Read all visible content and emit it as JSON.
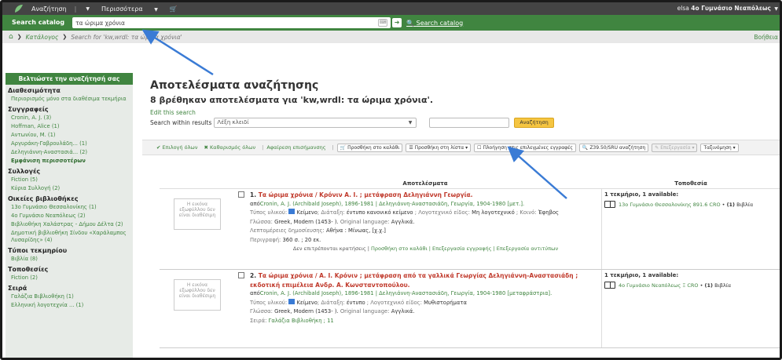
{
  "topbar": {
    "nav_search": "Αναζήτηση",
    "nav_more": "Περισσότερα",
    "user_name": "elsa",
    "user_library": "4ο Γυμνάσιο Νεαπόλεως"
  },
  "searchbar": {
    "tab_label": "Search catalog",
    "query": "τα ώριμα χρόνια",
    "submit_link": "Search catalog"
  },
  "breadcrumb": {
    "catalog": "Κατάλογος",
    "search_label": "Search",
    "search_query": "for 'kw,wrdl: τα ώριμα χρόνια'",
    "help": "Βοήθεια"
  },
  "sidebar": {
    "header": "Βελτιώστε την αναζήτησή σας",
    "availability": {
      "title": "Διαθεσιμότητα",
      "items": [
        "Περιορισμός μόνο στα διαθέσιμα τεκμήρια"
      ]
    },
    "authors": {
      "title": "Συγγραφείς",
      "items": [
        "Cronin, A. J. (3)",
        "Hoffman, Alice (1)",
        "Αντωνίου, Μ. (1)",
        "Αργυράκη-Γαβρουλάδη... (1)",
        "Δεληγιάννη-Αναστασιά... (2)"
      ],
      "more": "Εμφάνιση περισσοτέρων"
    },
    "collections": {
      "title": "Συλλογές",
      "items": [
        "Fiction (5)",
        "Κύρια Συλλογή (2)"
      ]
    },
    "home_libraries": {
      "title": "Οικείες βιβλιοθήκες",
      "items": [
        "13ο Γυμνάσιο Θεσσαλονίκης (1)",
        "4ο Γυμνάσιο Νεαπόλεως (2)",
        "Βιβλιοθήκη Χαλάστρας - Δήμου Δέλτα (2)",
        "Δημοτική βιβλιοθήκη Σίνδου «Χαράλαμπος Λυσαρίδης» (4)"
      ]
    },
    "item_types": {
      "title": "Τύποι τεκμηρίου",
      "items": [
        "Βιβλία (8)"
      ]
    },
    "locations": {
      "title": "Τοποθεσίες",
      "items": [
        "Fiction (2)"
      ]
    },
    "series": {
      "title": "Σειρά",
      "items": [
        "Γαλάζια Βιβλιοθήκη (1)",
        "Ελληνική λογοτεχνία ... (1)"
      ]
    }
  },
  "main": {
    "heading": "Αποτελέσματα αναζήτησης",
    "summary": "8 βρέθηκαν αποτελέσματα για 'kw,wrdl: τα ώριμα χρόνια'.",
    "edit_search": "Edit this search",
    "within_label": "Search within results",
    "within_select": "Λέξη κλειδί",
    "within_button": "Αναζήτηση"
  },
  "toolbar": {
    "select_all": "Επιλογή όλων",
    "clear_all": "Καθαρισμός όλων",
    "remove_highlight": "Αφαίρεση επισήμανσης",
    "add_cart": "Προσθήκη στο καλάθι",
    "add_list": "Προσθήκη στη λίστα",
    "merge": "Πλοήγηση στις επιλεγμένες εγγραφές",
    "z3950": "Z39.50/SRU αναζήτηση",
    "edit": "Επεξεργασία",
    "sort": "Ταξινόμηση"
  },
  "table": {
    "col_results": "Αποτελέσματα",
    "col_location": "Τοποθεσία",
    "no_image": "Η εικόνα εξωφύλλου δεν είναι διαθέσιμη",
    "rows": [
      {
        "num": "1.",
        "title": "Τα ώριμα χρόνια / Κρόνιν Α. Ι. ; μετάφραση Δεληγιάννη Γεωργία.",
        "by": "από",
        "authors": "Cronin, A. J. (Archibald Joseph), 1896-1981 | Δεληγιάννη-Αναστασιάδη, Γεωργία, 1904-1980 [μετ.].",
        "material_label": "Τύπος υλικού:",
        "material": "Κείμενο",
        "format_label": "Διάταξη:",
        "format": "έντυπο κανονικό κείμενο",
        "genre_label": "Λογοτεχνικό είδος:",
        "genre": "Μη λογοτεχνικό",
        "content_label": "Κοινό:",
        "content": "Έφηβος",
        "language_label": "Γλώσσα:",
        "language": "Greek, Modern (1453- ).",
        "orig_label": "Original language:",
        "orig": "Αγγλικά.",
        "pub_label": "Λεπτομέρειες δημοσίευσης:",
        "pub": "Αθήνα : Μίνωας, [χ.χ.]",
        "desc_label": "Περιγραφή:",
        "desc": "360 σ. ; 20 εκ.",
        "actions_text": "Δεν επιτρέπονται κρατήσεις |",
        "actions_links": "Προσθήκη στο καλάθι | Επεξεργασία εγγραφής | Επεξεργασία αντιτύπων",
        "avail": "1 τεκμήριο, 1 available:",
        "holding": "13ο Γυμνάσιο Θεσσαλονίκης 891.6 CRO",
        "holding_count": "(1)",
        "holding_type": "Βιβλία"
      },
      {
        "num": "2.",
        "title": "Τα ώριμα χρόνια / Α. Ι. Κρόνιν ; μετάφραση από τα γαλλικά Γεωργίας Δεληγιάννη-Αναστασιάδη ; εκδοτική επιμέλεια Ανδρ. Α. Κωνσταντοπούλου.",
        "by": "από",
        "authors": "Cronin, A. J. (Archibald Joseph), 1896-1981 | Δεληγιάννη-Αναστασιάδη, Γεωργία, 1904-1980 [μεταφράστρια].",
        "material_label": "Τύπος υλικού:",
        "material": "Κείμενο",
        "format_label": "Διάταξη:",
        "format": "έντυπο",
        "genre_label": "Λογοτεχνικό είδος:",
        "genre": "Μυθιστορήματα",
        "language_label": "Γλώσσα:",
        "language": "Greek, Modern (1453- ).",
        "orig_label": "Original language:",
        "orig": "Αγγλικά.",
        "series_label": "Σειρά:",
        "series": "Γαλάζια Βιβλιοθήκη ; 11",
        "avail": "1 τεκμήριο, 1 available:",
        "holding": "4ο Γυμνάσιο Νεαπόλεως Ξ CRO",
        "holding_count": "(1)",
        "holding_type": "Βιβλία"
      }
    ]
  },
  "colors": {
    "accent": "#408540",
    "topbar": "#444444",
    "title_red": "#c0392b",
    "highlight": "#fde9a6",
    "annotation_arrow": "#3a7bd5"
  }
}
